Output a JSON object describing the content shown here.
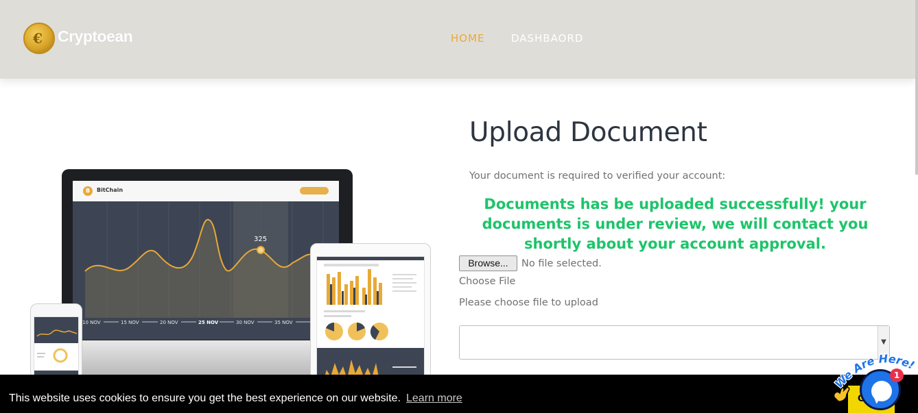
{
  "brand": {
    "name": "Cryptoean",
    "coin_symbol": "€"
  },
  "nav": {
    "items": [
      {
        "label": "HOME"
      },
      {
        "label": "DASHBAORD"
      }
    ],
    "active_color": "#e8a937"
  },
  "illustration": {
    "app_name": "BitChain",
    "coin_letter": "B",
    "point_value": "325",
    "x_labels": [
      "10 NOV",
      "15 NOV",
      "20 NOV",
      "25 NOV",
      "30 NOV",
      "35 NOV"
    ]
  },
  "form": {
    "title": "Upload Document",
    "intro": "Your document is required to verified your account:",
    "success_message": "Documents has be uploaded successfully! your documents is under review, we will contact you shortly about your account approval.",
    "browse_label": "Browse...",
    "file_status": "No file selected.",
    "file_label": "Choose File",
    "file_help": "Please choose file to upload",
    "select_value": "",
    "success_color": "#1dc46a"
  },
  "cookie": {
    "message": "This website uses cookies to ensure you get the best experience on our website.",
    "link_label": "Learn more",
    "button_label": "G"
  },
  "chat": {
    "badge_count": "1",
    "tagline": "We Are Here!"
  }
}
